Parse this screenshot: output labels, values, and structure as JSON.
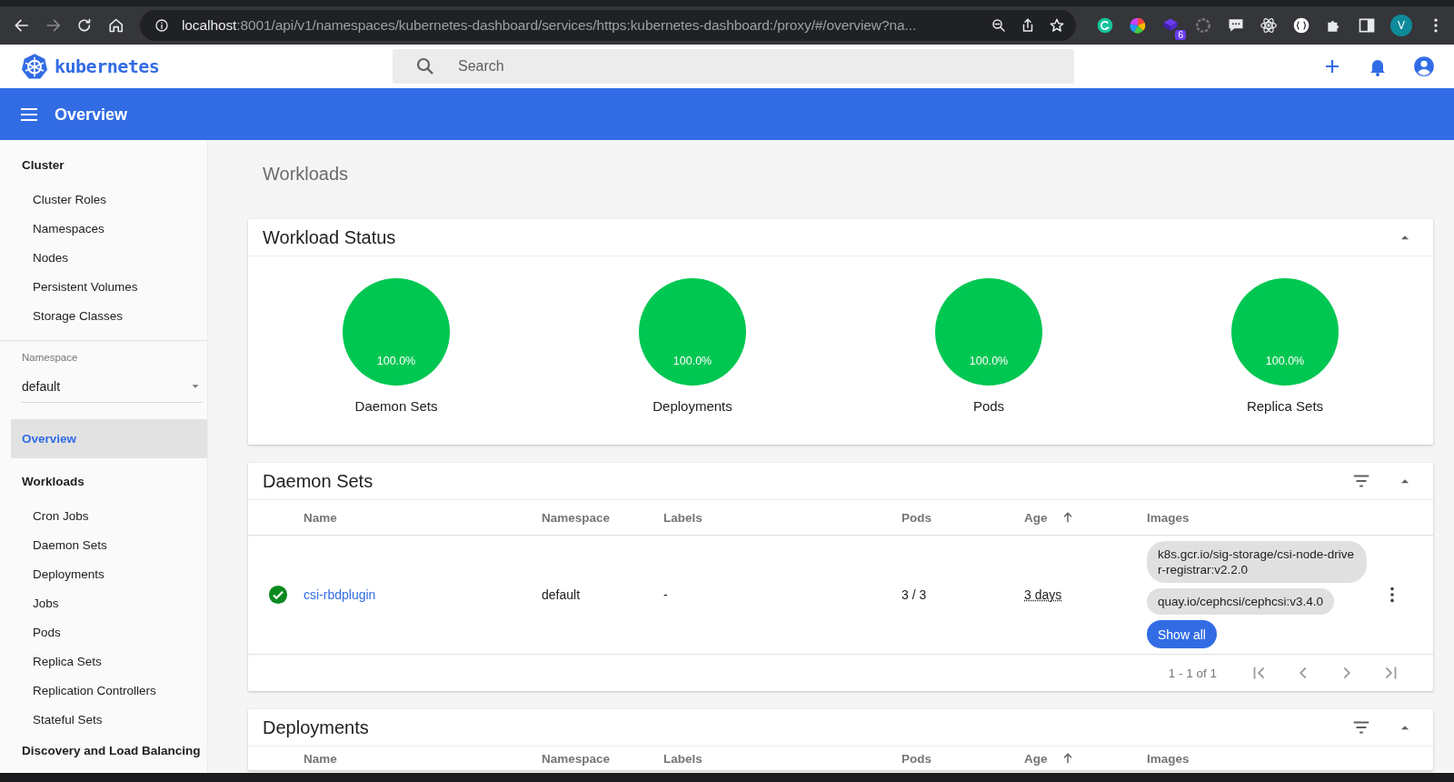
{
  "browser": {
    "url_host": "localhost",
    "url_rest": ":8001/api/v1/namespaces/kubernetes-dashboard/services/https:kubernetes-dashboard:/proxy/#/overview?na...",
    "extension_badge": "6",
    "profile_initial": "V"
  },
  "app": {
    "logo": "kubernetes",
    "search": {
      "placeholder": "Search"
    },
    "toolbar_title": "Overview"
  },
  "sidebar": {
    "sections": [
      {
        "kind": "group",
        "label": "Cluster",
        "children": [
          {
            "label": "Cluster Roles",
            "selected": false
          },
          {
            "label": "Namespaces",
            "selected": false
          },
          {
            "label": "Nodes",
            "selected": false
          },
          {
            "label": "Persistent Volumes",
            "selected": false
          },
          {
            "label": "Storage Classes",
            "selected": false
          }
        ]
      },
      {
        "kind": "namespace",
        "label": "Namespace",
        "value": "default"
      },
      {
        "kind": "link",
        "label": "Overview",
        "selected": true
      },
      {
        "kind": "group",
        "label": "Workloads",
        "children": [
          {
            "label": "Cron Jobs",
            "selected": false
          },
          {
            "label": "Daemon Sets",
            "selected": false
          },
          {
            "label": "Deployments",
            "selected": false
          },
          {
            "label": "Jobs",
            "selected": false
          },
          {
            "label": "Pods",
            "selected": false
          },
          {
            "label": "Replica Sets",
            "selected": false
          },
          {
            "label": "Replication Controllers",
            "selected": false
          },
          {
            "label": "Stateful Sets",
            "selected": false
          }
        ]
      },
      {
        "kind": "group",
        "label": "Discovery and Load Balancing"
      }
    ]
  },
  "main": {
    "page_title": "Workloads",
    "workload_status": {
      "title": "Workload Status",
      "charts": [
        {
          "label": "Daemon Sets",
          "percent": "100.0%",
          "level": 1
        },
        {
          "label": "Deployments",
          "percent": "100.0%",
          "level": 1
        },
        {
          "label": "Pods",
          "percent": "100.0%",
          "level": 1
        },
        {
          "label": "Replica Sets",
          "percent": "100.0%",
          "level": 1
        }
      ]
    },
    "daemon_sets": {
      "title": "Daemon Sets",
      "columns": [
        "Name",
        "Namespace",
        "Labels",
        "Pods",
        "Age",
        "Images"
      ],
      "rows": [
        {
          "healthy": true,
          "name": "csi-rbdplugin",
          "namespace": "default",
          "labels": "-",
          "pods": "3 / 3",
          "age": "3 days",
          "images": [
            "k8s.gcr.io/sig-storage/csi-node-driver-registrar:v2.2.0",
            "quay.io/cephcsi/cephcsi:v3.4.0"
          ],
          "show_all": "Show all"
        }
      ],
      "pagination": "1 - 1 of 1"
    },
    "deployments": {
      "title": "Deployments",
      "columns": [
        "Name",
        "Namespace",
        "Labels",
        "Pods",
        "Age",
        "Images"
      ]
    }
  }
}
